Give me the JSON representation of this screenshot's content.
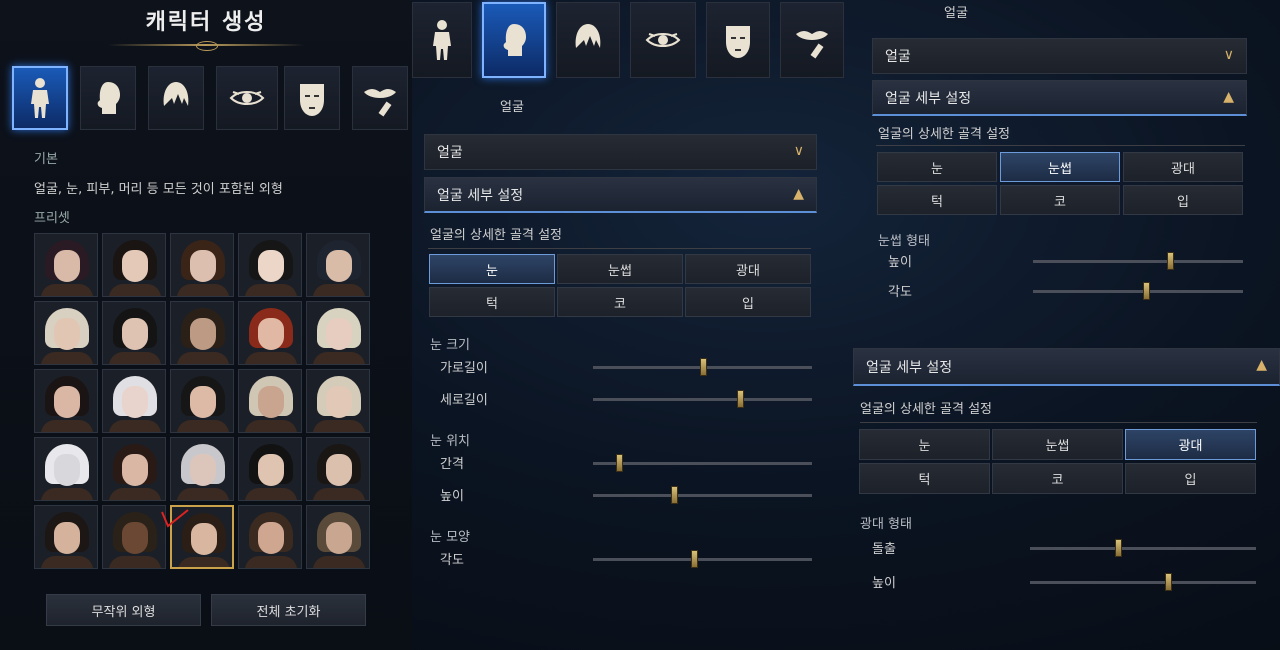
{
  "p1": {
    "title": "캐릭터 생성",
    "basic_label": "기본",
    "description": "얼굴, 눈, 피부, 머리 등 모든 것이 포함된 외형",
    "preset_label": "프리셋",
    "random_button": "무작위 외형",
    "reset_button": "전체 초기화"
  },
  "p2": {
    "category_label": "얼굴",
    "face_header": "얼굴",
    "detail_header": "얼굴 세부 설정",
    "detail_sub": "얼굴의 상세한 골격 설정",
    "tabs": [
      "눈",
      "눈썹",
      "광대",
      "턱",
      "코",
      "입"
    ],
    "sections": [
      {
        "title": "눈 크기",
        "sliders": [
          {
            "label": "가로길이",
            "value": 0.5
          },
          {
            "label": "세로길이",
            "value": 0.67
          }
        ]
      },
      {
        "title": "눈 위치",
        "sliders": [
          {
            "label": "간격",
            "value": 0.12
          },
          {
            "label": "높이",
            "value": 0.37
          }
        ]
      },
      {
        "title": "눈 모양",
        "sliders": [
          {
            "label": "각도",
            "value": 0.46
          }
        ]
      }
    ]
  },
  "p3": {
    "category_label": "얼굴",
    "face_header": "얼굴",
    "detail_header": "얼굴 세부 설정",
    "detail_sub": "얼굴의 상세한 골격 설정",
    "tabs": [
      "눈",
      "눈썹",
      "광대",
      "턱",
      "코",
      "입"
    ],
    "brow_section": {
      "title": "눈썹 형태",
      "sliders": [
        {
          "label": "높이",
          "value": 0.65
        },
        {
          "label": "각도",
          "value": 0.54
        }
      ]
    },
    "detail_header2": "얼굴 세부 설정",
    "detail_sub2": "얼굴의 상세한 골격 설정",
    "tabs2": [
      "눈",
      "눈썹",
      "광대",
      "턱",
      "코",
      "입"
    ],
    "cheek_section": {
      "title": "광대 형태",
      "sliders": [
        {
          "label": "돌출",
          "value": 0.39
        },
        {
          "label": "높이",
          "value": 0.61
        }
      ]
    }
  },
  "icons": [
    "body-icon",
    "head-icon",
    "hair-icon",
    "eye-icon",
    "mask-icon",
    "lips-icon"
  ],
  "colors": {
    "accent": "#5d8fd6",
    "gold": "#d8b26a",
    "active_tab": "#2e4466"
  }
}
